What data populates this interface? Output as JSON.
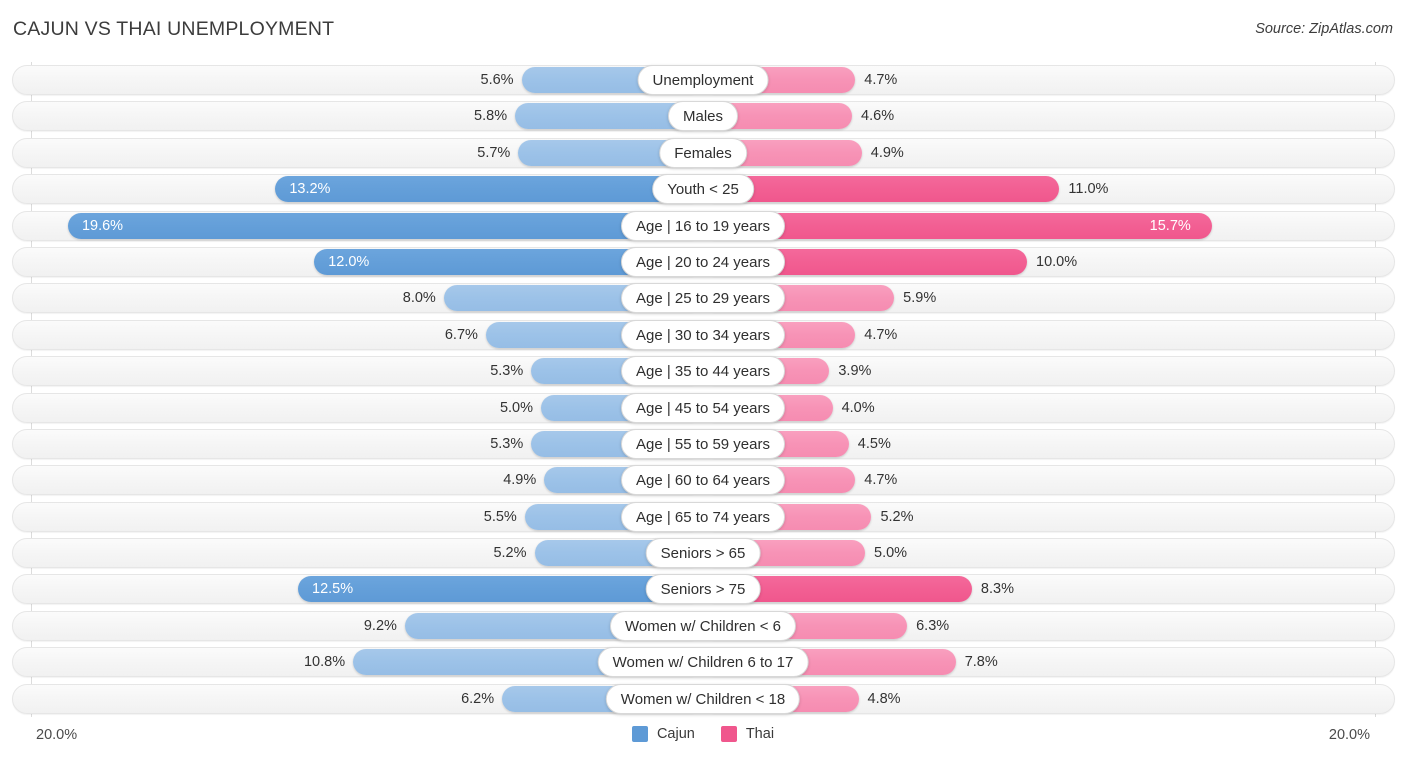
{
  "header": {
    "title": "CAJUN VS THAI UNEMPLOYMENT",
    "source": "Source: ZipAtlas.com"
  },
  "axis": {
    "left_label": "20.0%",
    "right_label": "20.0%",
    "max": 20.0
  },
  "legend": {
    "items": [
      {
        "label": "Cajun",
        "color": "#5e9ad6"
      },
      {
        "label": "Thai",
        "color": "#f0578d"
      }
    ]
  },
  "colors": {
    "cajun_light": "#9cc2e8",
    "cajun_dark": "#649fd9",
    "thai_light": "#f793b6",
    "thai_dark": "#f25f93",
    "track": "#f4f4f4",
    "gridline": "#dcdcdc"
  },
  "chart_data": {
    "type": "bar",
    "orientation": "horizontal",
    "style": "diverging-bidirectional",
    "title": "CAJUN VS THAI UNEMPLOYMENT",
    "source": "Source: ZipAtlas.com",
    "xlabel": "",
    "ylabel": "",
    "xlim": [
      20.0,
      20.0
    ],
    "axis_left_tick": "20.0%",
    "axis_right_tick": "20.0%",
    "grid": true,
    "legend_position": "bottom-center",
    "units": "percent",
    "categories": [
      "Unemployment",
      "Males",
      "Females",
      "Youth < 25",
      "Age | 16 to 19 years",
      "Age | 20 to 24 years",
      "Age | 25 to 29 years",
      "Age | 30 to 34 years",
      "Age | 35 to 44 years",
      "Age | 45 to 54 years",
      "Age | 55 to 59 years",
      "Age | 60 to 64 years",
      "Age | 65 to 74 years",
      "Seniors > 65",
      "Seniors > 75",
      "Women w/ Children < 6",
      "Women w/ Children 6 to 17",
      "Women w/ Children < 18"
    ],
    "series": [
      {
        "name": "Cajun",
        "side": "left",
        "color": "#9cc2e8",
        "values": [
          5.6,
          5.8,
          5.7,
          13.2,
          19.6,
          12.0,
          8.0,
          6.7,
          5.3,
          5.0,
          5.3,
          4.9,
          5.5,
          5.2,
          12.5,
          9.2,
          10.8,
          6.2
        ],
        "labels": [
          "5.6%",
          "5.8%",
          "5.7%",
          "13.2%",
          "19.6%",
          "12.0%",
          "8.0%",
          "6.7%",
          "5.3%",
          "5.0%",
          "5.3%",
          "4.9%",
          "5.5%",
          "5.2%",
          "12.5%",
          "9.2%",
          "10.8%",
          "6.2%"
        ]
      },
      {
        "name": "Thai",
        "side": "right",
        "color": "#f793b6",
        "values": [
          4.7,
          4.6,
          4.9,
          11.0,
          15.7,
          10.0,
          5.9,
          4.7,
          3.9,
          4.0,
          4.5,
          4.7,
          5.2,
          5.0,
          8.3,
          6.3,
          7.8,
          4.8
        ],
        "labels": [
          "4.7%",
          "4.6%",
          "4.9%",
          "11.0%",
          "15.7%",
          "10.0%",
          "5.9%",
          "4.7%",
          "3.9%",
          "4.0%",
          "4.5%",
          "4.7%",
          "5.2%",
          "5.0%",
          "8.3%",
          "6.3%",
          "7.8%",
          "4.8%"
        ]
      }
    ],
    "rows": [
      {
        "category": "Unemployment",
        "cajun": 5.6,
        "cajun_label": "5.6%",
        "thai": 4.7,
        "thai_label": "4.7%",
        "highlight": false
      },
      {
        "category": "Males",
        "cajun": 5.8,
        "cajun_label": "5.8%",
        "thai": 4.6,
        "thai_label": "4.6%",
        "highlight": false
      },
      {
        "category": "Females",
        "cajun": 5.7,
        "cajun_label": "5.7%",
        "thai": 4.9,
        "thai_label": "4.9%",
        "highlight": false
      },
      {
        "category": "Youth < 25",
        "cajun": 13.2,
        "cajun_label": "13.2%",
        "thai": 11.0,
        "thai_label": "11.0%",
        "highlight": true
      },
      {
        "category": "Age | 16 to 19 years",
        "cajun": 19.6,
        "cajun_label": "19.6%",
        "thai": 15.7,
        "thai_label": "15.7%",
        "highlight": true
      },
      {
        "category": "Age | 20 to 24 years",
        "cajun": 12.0,
        "cajun_label": "12.0%",
        "thai": 10.0,
        "thai_label": "10.0%",
        "highlight": true
      },
      {
        "category": "Age | 25 to 29 years",
        "cajun": 8.0,
        "cajun_label": "8.0%",
        "thai": 5.9,
        "thai_label": "5.9%",
        "highlight": false
      },
      {
        "category": "Age | 30 to 34 years",
        "cajun": 6.7,
        "cajun_label": "6.7%",
        "thai": 4.7,
        "thai_label": "4.7%",
        "highlight": false
      },
      {
        "category": "Age | 35 to 44 years",
        "cajun": 5.3,
        "cajun_label": "5.3%",
        "thai": 3.9,
        "thai_label": "3.9%",
        "highlight": false
      },
      {
        "category": "Age | 45 to 54 years",
        "cajun": 5.0,
        "cajun_label": "5.0%",
        "thai": 4.0,
        "thai_label": "4.0%",
        "highlight": false
      },
      {
        "category": "Age | 55 to 59 years",
        "cajun": 5.3,
        "cajun_label": "5.3%",
        "thai": 4.5,
        "thai_label": "4.5%",
        "highlight": false
      },
      {
        "category": "Age | 60 to 64 years",
        "cajun": 4.9,
        "cajun_label": "4.9%",
        "thai": 4.7,
        "thai_label": "4.7%",
        "highlight": false
      },
      {
        "category": "Age | 65 to 74 years",
        "cajun": 5.5,
        "cajun_label": "5.5%",
        "thai": 5.2,
        "thai_label": "5.2%",
        "highlight": false
      },
      {
        "category": "Seniors > 65",
        "cajun": 5.2,
        "cajun_label": "5.2%",
        "thai": 5.0,
        "thai_label": "5.0%",
        "highlight": false
      },
      {
        "category": "Seniors > 75",
        "cajun": 12.5,
        "cajun_label": "12.5%",
        "thai": 8.3,
        "thai_label": "8.3%",
        "highlight": true
      },
      {
        "category": "Women w/ Children < 6",
        "cajun": 9.2,
        "cajun_label": "9.2%",
        "thai": 6.3,
        "thai_label": "6.3%",
        "highlight": false
      },
      {
        "category": "Women w/ Children 6 to 17",
        "cajun": 10.8,
        "cajun_label": "10.8%",
        "thai": 7.8,
        "thai_label": "7.8%",
        "highlight": false
      },
      {
        "category": "Women w/ Children < 18",
        "cajun": 6.2,
        "cajun_label": "6.2%",
        "thai": 4.8,
        "thai_label": "4.8%",
        "highlight": false
      }
    ]
  }
}
